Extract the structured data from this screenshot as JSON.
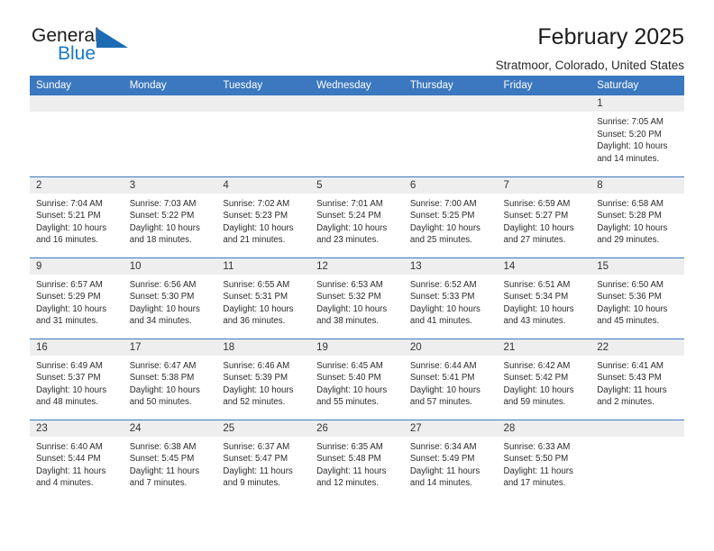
{
  "brand": {
    "name_part1": "General",
    "name_part2": "Blue",
    "logo_icon": "blue-flag-triangle-icon",
    "accent_color": "#1b78c2"
  },
  "header": {
    "month_title": "February 2025",
    "location": "Stratmoor, Colorado, United States"
  },
  "theme": {
    "header_blue": "#3b78bf",
    "daynum_bg": "#eeeeee",
    "text_color": "#2b2b2b"
  },
  "calendar": {
    "weekday_headers": [
      "Sunday",
      "Monday",
      "Tuesday",
      "Wednesday",
      "Thursday",
      "Friday",
      "Saturday"
    ],
    "weeks": [
      [
        {
          "empty": true
        },
        {
          "empty": true
        },
        {
          "empty": true
        },
        {
          "empty": true
        },
        {
          "empty": true
        },
        {
          "empty": true
        },
        {
          "day": "1",
          "sunrise": "Sunrise: 7:05 AM",
          "sunset": "Sunset: 5:20 PM",
          "daylight1": "Daylight: 10 hours",
          "daylight2": "and 14 minutes."
        }
      ],
      [
        {
          "day": "2",
          "sunrise": "Sunrise: 7:04 AM",
          "sunset": "Sunset: 5:21 PM",
          "daylight1": "Daylight: 10 hours",
          "daylight2": "and 16 minutes."
        },
        {
          "day": "3",
          "sunrise": "Sunrise: 7:03 AM",
          "sunset": "Sunset: 5:22 PM",
          "daylight1": "Daylight: 10 hours",
          "daylight2": "and 18 minutes."
        },
        {
          "day": "4",
          "sunrise": "Sunrise: 7:02 AM",
          "sunset": "Sunset: 5:23 PM",
          "daylight1": "Daylight: 10 hours",
          "daylight2": "and 21 minutes."
        },
        {
          "day": "5",
          "sunrise": "Sunrise: 7:01 AM",
          "sunset": "Sunset: 5:24 PM",
          "daylight1": "Daylight: 10 hours",
          "daylight2": "and 23 minutes."
        },
        {
          "day": "6",
          "sunrise": "Sunrise: 7:00 AM",
          "sunset": "Sunset: 5:25 PM",
          "daylight1": "Daylight: 10 hours",
          "daylight2": "and 25 minutes."
        },
        {
          "day": "7",
          "sunrise": "Sunrise: 6:59 AM",
          "sunset": "Sunset: 5:27 PM",
          "daylight1": "Daylight: 10 hours",
          "daylight2": "and 27 minutes."
        },
        {
          "day": "8",
          "sunrise": "Sunrise: 6:58 AM",
          "sunset": "Sunset: 5:28 PM",
          "daylight1": "Daylight: 10 hours",
          "daylight2": "and 29 minutes."
        }
      ],
      [
        {
          "day": "9",
          "sunrise": "Sunrise: 6:57 AM",
          "sunset": "Sunset: 5:29 PM",
          "daylight1": "Daylight: 10 hours",
          "daylight2": "and 31 minutes."
        },
        {
          "day": "10",
          "sunrise": "Sunrise: 6:56 AM",
          "sunset": "Sunset: 5:30 PM",
          "daylight1": "Daylight: 10 hours",
          "daylight2": "and 34 minutes."
        },
        {
          "day": "11",
          "sunrise": "Sunrise: 6:55 AM",
          "sunset": "Sunset: 5:31 PM",
          "daylight1": "Daylight: 10 hours",
          "daylight2": "and 36 minutes."
        },
        {
          "day": "12",
          "sunrise": "Sunrise: 6:53 AM",
          "sunset": "Sunset: 5:32 PM",
          "daylight1": "Daylight: 10 hours",
          "daylight2": "and 38 minutes."
        },
        {
          "day": "13",
          "sunrise": "Sunrise: 6:52 AM",
          "sunset": "Sunset: 5:33 PM",
          "daylight1": "Daylight: 10 hours",
          "daylight2": "and 41 minutes."
        },
        {
          "day": "14",
          "sunrise": "Sunrise: 6:51 AM",
          "sunset": "Sunset: 5:34 PM",
          "daylight1": "Daylight: 10 hours",
          "daylight2": "and 43 minutes."
        },
        {
          "day": "15",
          "sunrise": "Sunrise: 6:50 AM",
          "sunset": "Sunset: 5:36 PM",
          "daylight1": "Daylight: 10 hours",
          "daylight2": "and 45 minutes."
        }
      ],
      [
        {
          "day": "16",
          "sunrise": "Sunrise: 6:49 AM",
          "sunset": "Sunset: 5:37 PM",
          "daylight1": "Daylight: 10 hours",
          "daylight2": "and 48 minutes."
        },
        {
          "day": "17",
          "sunrise": "Sunrise: 6:47 AM",
          "sunset": "Sunset: 5:38 PM",
          "daylight1": "Daylight: 10 hours",
          "daylight2": "and 50 minutes."
        },
        {
          "day": "18",
          "sunrise": "Sunrise: 6:46 AM",
          "sunset": "Sunset: 5:39 PM",
          "daylight1": "Daylight: 10 hours",
          "daylight2": "and 52 minutes."
        },
        {
          "day": "19",
          "sunrise": "Sunrise: 6:45 AM",
          "sunset": "Sunset: 5:40 PM",
          "daylight1": "Daylight: 10 hours",
          "daylight2": "and 55 minutes."
        },
        {
          "day": "20",
          "sunrise": "Sunrise: 6:44 AM",
          "sunset": "Sunset: 5:41 PM",
          "daylight1": "Daylight: 10 hours",
          "daylight2": "and 57 minutes."
        },
        {
          "day": "21",
          "sunrise": "Sunrise: 6:42 AM",
          "sunset": "Sunset: 5:42 PM",
          "daylight1": "Daylight: 10 hours",
          "daylight2": "and 59 minutes."
        },
        {
          "day": "22",
          "sunrise": "Sunrise: 6:41 AM",
          "sunset": "Sunset: 5:43 PM",
          "daylight1": "Daylight: 11 hours",
          "daylight2": "and 2 minutes."
        }
      ],
      [
        {
          "day": "23",
          "sunrise": "Sunrise: 6:40 AM",
          "sunset": "Sunset: 5:44 PM",
          "daylight1": "Daylight: 11 hours",
          "daylight2": "and 4 minutes."
        },
        {
          "day": "24",
          "sunrise": "Sunrise: 6:38 AM",
          "sunset": "Sunset: 5:45 PM",
          "daylight1": "Daylight: 11 hours",
          "daylight2": "and 7 minutes."
        },
        {
          "day": "25",
          "sunrise": "Sunrise: 6:37 AM",
          "sunset": "Sunset: 5:47 PM",
          "daylight1": "Daylight: 11 hours",
          "daylight2": "and 9 minutes."
        },
        {
          "day": "26",
          "sunrise": "Sunrise: 6:35 AM",
          "sunset": "Sunset: 5:48 PM",
          "daylight1": "Daylight: 11 hours",
          "daylight2": "and 12 minutes."
        },
        {
          "day": "27",
          "sunrise": "Sunrise: 6:34 AM",
          "sunset": "Sunset: 5:49 PM",
          "daylight1": "Daylight: 11 hours",
          "daylight2": "and 14 minutes."
        },
        {
          "day": "28",
          "sunrise": "Sunrise: 6:33 AM",
          "sunset": "Sunset: 5:50 PM",
          "daylight1": "Daylight: 11 hours",
          "daylight2": "and 17 minutes."
        },
        {
          "empty": true
        }
      ]
    ]
  }
}
